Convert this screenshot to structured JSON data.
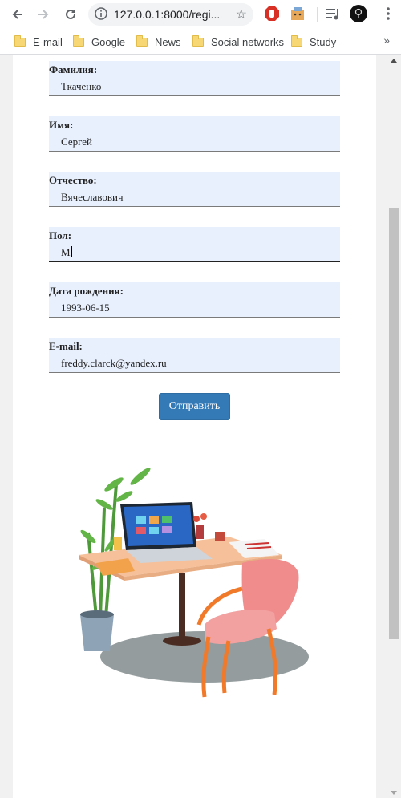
{
  "browser": {
    "url": "127.0.0.1:8000/regi...",
    "bookmarks": [
      "E-mail",
      "Google",
      "News",
      "Social networks",
      "Study"
    ],
    "more_label": "»"
  },
  "form": {
    "fields": [
      {
        "label": "Фамилия:",
        "value": "Ткаченко"
      },
      {
        "label": "Имя:",
        "value": "Сергей"
      },
      {
        "label": "Отчество:",
        "value": "Вячеславович"
      },
      {
        "label": "Пол:",
        "value": "М"
      },
      {
        "label": "Дата рождения:",
        "value": "1993-06-15"
      },
      {
        "label": "E-mail:",
        "value": "freddy.clarck@yandex.ru"
      }
    ],
    "submit_label": "Отправить"
  },
  "colors": {
    "field_bg": "#e8f0fe",
    "button_bg": "#337ab7"
  },
  "icons": {
    "back": "arrow-left-icon",
    "forward": "arrow-right-icon",
    "reload": "reload-icon",
    "info": "info-icon",
    "star": "star-icon",
    "adblock": "stop-hand-icon",
    "extension": "extension-icon",
    "media": "media-queue-icon",
    "profile": "avatar-icon",
    "menu": "kebab-menu-icon"
  }
}
